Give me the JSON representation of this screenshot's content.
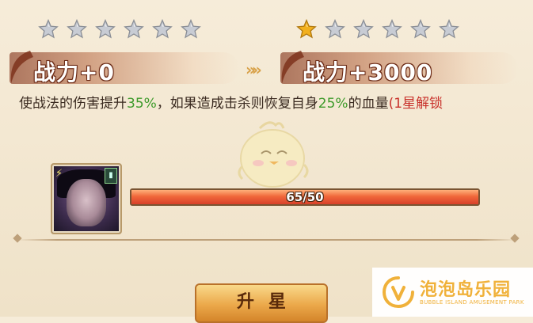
{
  "left_panel": {
    "stars_filled": 0,
    "stars_total": 6,
    "power_label": "战力+0"
  },
  "right_panel": {
    "stars_filled": 1,
    "stars_total": 6,
    "power_label": "战力+3000"
  },
  "arrows": "»",
  "description": {
    "part1": "使战法的伤害提升",
    "value1": "35%",
    "part2": "，如果造成击杀则恢复自身",
    "value2": "25%",
    "part3": "的血量",
    "unlock": "(1星解锁"
  },
  "progress": {
    "current": 65,
    "required": 50,
    "text": "65/50",
    "fill_fraction": 1.0
  },
  "upgrade_button": {
    "label": "升星"
  },
  "watermark": {
    "title": "泡泡岛乐园",
    "subtitle": "BUBBLE ISLAND AMUSEMENT PARK"
  },
  "colors": {
    "star_gold": "#f2b01e",
    "star_silver": "#c8ccd4",
    "highlight_green": "#3d9a2a",
    "highlight_red": "#c8302a",
    "progress_fill": "#f0683a",
    "button_gold": "#eba84a",
    "logo_orange": "#f0b13a"
  },
  "icons": {
    "star_empty": "star-empty-icon",
    "star_filled": "star-filled-icon",
    "hero_portrait": "hero-portrait-icon",
    "mascot": "mascot-chick-icon",
    "logo": "bubble-island-logo-icon"
  }
}
